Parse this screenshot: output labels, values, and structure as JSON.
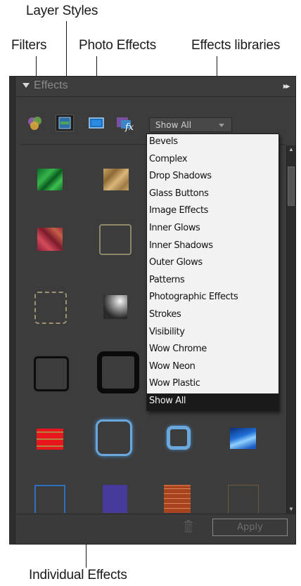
{
  "callouts": {
    "layer_styles": "Layer Styles",
    "filters": "Filters",
    "photo_effects": "Photo Effects",
    "effects_libraries": "Effects libraries",
    "individual_effects": "Individual Effects"
  },
  "panel": {
    "title": "Effects",
    "menu_icon": "panel-menu-icon"
  },
  "toolbar": {
    "icons": [
      "filters-icon",
      "layer-styles-icon",
      "photo-effects-icon",
      "show-all-effects-icon"
    ]
  },
  "dropdown": {
    "value": "Show All",
    "options": [
      "Bevels",
      "Complex",
      "Drop Shadows",
      "Glass Buttons",
      "Image Effects",
      "Inner Glows",
      "Inner Shadows",
      "Outer Glows",
      "Patterns",
      "Photographic Effects",
      "Strokes",
      "Visibility",
      "Wow Chrome",
      "Wow Neon",
      "Wow Plastic",
      "Show All"
    ],
    "selected_index": 15
  },
  "footer": {
    "apply_label": "Apply"
  },
  "colors": {
    "panel_bg": "#3c3c3c",
    "list_bg": "#f2f2f2",
    "selected_bg": "#1a1a1a"
  }
}
